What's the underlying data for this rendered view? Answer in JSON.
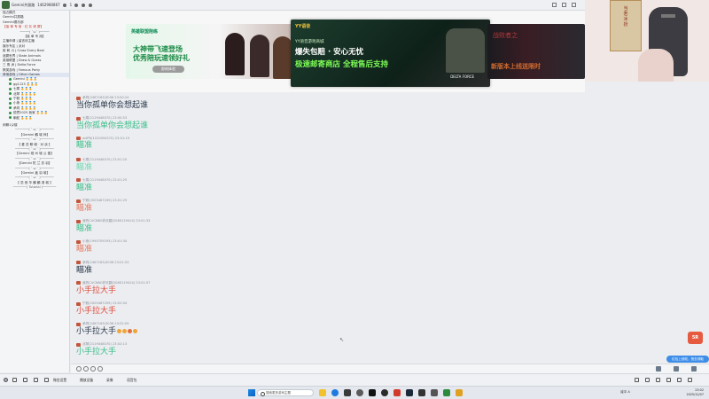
{
  "topbar": {
    "channel_name": "Gemini共振路",
    "channel_id": "1462980867",
    "count": "1"
  },
  "sidebar": {
    "rows": [
      {
        "text": "独占模式",
        "style": "plain"
      },
      {
        "text": "Gemini共振路",
        "style": "plain"
      },
      {
        "text": "Gemini俱乐部",
        "style": "plain"
      },
      {
        "text": "【接 单 专 用 · 红 灰 滚 屏】",
        "style": "red"
      },
      {
        "text": "─────( ˘ω˘ )─────",
        "style": "deco"
      },
      {
        "text": "【接 单 专 用】",
        "style": "center"
      },
      {
        "text": "主播申请 | 留言待主播",
        "style": "plain"
      },
      {
        "text": "娱乐专区 | 派对",
        "style": "plain"
      },
      {
        "text": "射 和 川 | Cross Every Best",
        "style": "plain"
      },
      {
        "text": "迷雾世界 | State Animals",
        "style": "plain"
      },
      {
        "text": "英雄联盟 | Draw & Guess",
        "style": "plain"
      },
      {
        "text": "三 角 洲 | Delta Force",
        "style": "plain"
      },
      {
        "text": "棋类游戏 | Famous Party",
        "style": "plain"
      },
      {
        "text": "其他游戏 | Other Games",
        "style": "sel"
      }
    ],
    "users": [
      {
        "name": "Gemini 🏅🏅🏅"
      },
      {
        "name": "gg1123 🏅🏅🏅"
      },
      {
        "name": "七寒 🏅🏅🏅"
      },
      {
        "name": "北琴 🏅🏅🏅🏅"
      },
      {
        "name": "宁毅 🏅🏅🏅"
      },
      {
        "name": "小熊 🏅🏅🏅🏅"
      },
      {
        "name": "承同 🏅🏅🏅🏅"
      },
      {
        "name": "锐思2025 我家 🏅🏅🏅"
      },
      {
        "name": "躺蛇 🏅🏅🏅"
      }
    ],
    "rows2": [
      {
        "text": "闲聊1|2楼",
        "style": "plain"
      },
      {
        "text": "───────( ᵔ ω ᵔ )───────",
        "style": "deco"
      },
      {
        "text": "【Gemini 麟 城 师】",
        "style": "center"
      },
      {
        "text": "───────( ᵔ ω ᵔ )───────",
        "style": "deco"
      },
      {
        "text": "【 爱 恋 聊 城 · 对 谈 】",
        "style": "center"
      },
      {
        "text": "───────( ᵔ ω ᵔ )───────",
        "style": "deco"
      },
      {
        "text": "【Gemini 观 州 城 公 墨】",
        "style": "center"
      },
      {
        "text": "───────( ᵔ ω ᵔ )───────",
        "style": "deco"
      },
      {
        "text": "【Gemini 陀 兰 苏 羽】",
        "style": "center"
      },
      {
        "text": "───────( ᵔ ω ᵔ )───────",
        "style": "deco"
      },
      {
        "text": "【Gemini 鑫 羽 城】",
        "style": "center"
      },
      {
        "text": "───────( ᵔ ω ᵔ )───────",
        "style": "deco"
      },
      {
        "text": "【 恋 音 华 麟 麟 滨 城 】",
        "style": "center"
      },
      {
        "text": "───────( Tutorial )───────",
        "style": "deco"
      }
    ]
  },
  "banner": {
    "ad1": {
      "brand": "英雄联盟陪练",
      "line1": "英雄联盟陪练",
      "line2": "大神带飞速登场",
      "line3": "优秀陪玩速领好礼",
      "button": "即刻体验"
    },
    "ad2": {
      "brand": "YY语音",
      "sub": "YY语音游戏商城",
      "line2": "爆失包赔 · 安心无忧",
      "line3": "极速邮寄商店 全程售后支持",
      "footer": "DELTA FORCE"
    },
    "ad3": {
      "t1": "战败者之",
      "t2": "新版本上线送限时"
    }
  },
  "right_panel": {
    "scroll_text": [
      "当",
      "若",
      "冰",
      "扮"
    ]
  },
  "messages": [
    {
      "head": "承同(2467163)3036  23:00:24",
      "text": "当你孤单你会想起谁",
      "color": "#2c3a4d",
      "emotes": []
    },
    {
      "head": "七寒(2119448070)  23:00:53",
      "text": "当你孤单你会想起谁",
      "color": "#3bbf8a",
      "emotes": []
    },
    {
      "head": "w4PN(1220094570)  23:01:19",
      "text": "瞄准",
      "color": "#3bbf8a",
      "emotes": []
    },
    {
      "head": "七寒(2119448070)  23:01:20",
      "text": "瞄准",
      "color": "#73d9b0",
      "emotes": []
    },
    {
      "head": "七寒(2119448070)  23:01:25",
      "text": "瞄准",
      "color": "#3bbf8a",
      "emotes": []
    },
    {
      "head": "宁毅(2005467209)  23:01:29",
      "text": "瞄准",
      "color": "#e57a5f",
      "emotes": []
    },
    {
      "head": "我的CUCNBG炸天翻(2080119414)  23:01:33",
      "text": "瞄准",
      "color": "#3bbf8a",
      "emotes": []
    },
    {
      "head": "小熊(1990709293)  23:01:34",
      "text": "瞄准",
      "color": "#e57a5f",
      "emotes": []
    },
    {
      "head": "承同(2467163)3036  23:01:53",
      "text": "瞄准",
      "color": "#2c3a4d",
      "emotes": []
    },
    {
      "head": "我的CUCNBG炸天翻(2080119414)  23:01:57",
      "text": "小手拉大手",
      "color": "#e24b3b",
      "emotes": []
    },
    {
      "head": "宁毅(2005467209)  23:02:04",
      "text": "小手拉大手",
      "color": "#e24b3b",
      "emotes": []
    },
    {
      "head": "承同(2467163)3036  23:02:09",
      "text": "小手拉大手",
      "color": "#2c3a4d",
      "emotes": [
        "#f0a53a",
        "#f0a53a",
        "#e36f3a",
        "#f0a53a"
      ]
    },
    {
      "head": "北琴(2119448070)  23:02:13",
      "text": "小手拉大手",
      "color": "#3bbf8a",
      "emotes": []
    }
  ],
  "statusbar": {
    "item1": "微信设置",
    "item2": "播放设备",
    "item3": "录像",
    "item4": "语音包"
  },
  "taskbar": {
    "search_placeholder": "搜索更多游戏主题",
    "tray_text": "诚中 A",
    "time": "23:02",
    "date": "2025/12/07"
  },
  "float": {
    "badge": "5R"
  },
  "notify": {
    "text": "红包上线啦，快去领取"
  }
}
